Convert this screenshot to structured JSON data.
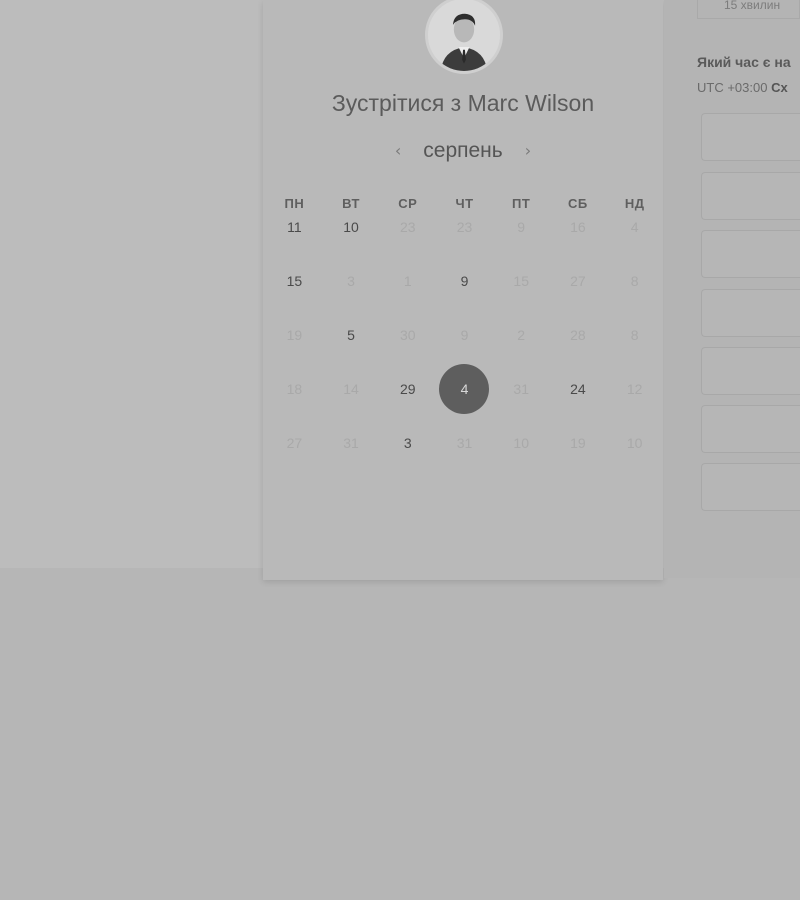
{
  "host": {
    "meet_prefix": "Зустрітися з",
    "name": "Marc Wilson"
  },
  "calendar": {
    "month": "серпень",
    "prev_icon": "chevron-left-icon",
    "next_icon": "chevron-right-icon",
    "weekdays": [
      "ПН",
      "ВТ",
      "СР",
      "ЧТ",
      "ПТ",
      "СБ",
      "НД"
    ],
    "weeks": [
      [
        {
          "d": "11",
          "s": "active"
        },
        {
          "d": "10",
          "s": "active"
        },
        {
          "d": "23",
          "s": "disabled"
        },
        {
          "d": "23",
          "s": "disabled"
        },
        {
          "d": "9",
          "s": "disabled"
        },
        {
          "d": "16",
          "s": "disabled"
        },
        {
          "d": "4",
          "s": "disabled"
        }
      ],
      [
        {
          "d": "15",
          "s": "active"
        },
        {
          "d": "3",
          "s": "disabled"
        },
        {
          "d": "1",
          "s": "disabled"
        },
        {
          "d": "9",
          "s": "active"
        },
        {
          "d": "15",
          "s": "disabled"
        },
        {
          "d": "27",
          "s": "disabled"
        },
        {
          "d": "8",
          "s": "disabled"
        }
      ],
      [
        {
          "d": "19",
          "s": "disabled"
        },
        {
          "d": "5",
          "s": "active"
        },
        {
          "d": "30",
          "s": "disabled"
        },
        {
          "d": "9",
          "s": "disabled"
        },
        {
          "d": "2",
          "s": "disabled"
        },
        {
          "d": "28",
          "s": "disabled"
        },
        {
          "d": "8",
          "s": "disabled"
        }
      ],
      [
        {
          "d": "18",
          "s": "disabled"
        },
        {
          "d": "14",
          "s": "disabled"
        },
        {
          "d": "29",
          "s": "active"
        },
        {
          "d": "4",
          "s": "selected"
        },
        {
          "d": "31",
          "s": "disabled"
        },
        {
          "d": "24",
          "s": "active"
        },
        {
          "d": "12",
          "s": "disabled"
        }
      ],
      [
        {
          "d": "27",
          "s": "disabled"
        },
        {
          "d": "31",
          "s": "disabled"
        },
        {
          "d": "3",
          "s": "active"
        },
        {
          "d": "31",
          "s": "disabled"
        },
        {
          "d": "10",
          "s": "disabled"
        },
        {
          "d": "19",
          "s": "disabled"
        },
        {
          "d": "10",
          "s": "disabled"
        }
      ]
    ]
  },
  "booking": {
    "duration": "15 хвилин",
    "time_question": "Який час є на",
    "timezone_offset": "UTC +03:00",
    "timezone_name": "Сх",
    "slots": [
      "",
      "",
      "",
      "",
      "",
      "",
      ""
    ]
  }
}
